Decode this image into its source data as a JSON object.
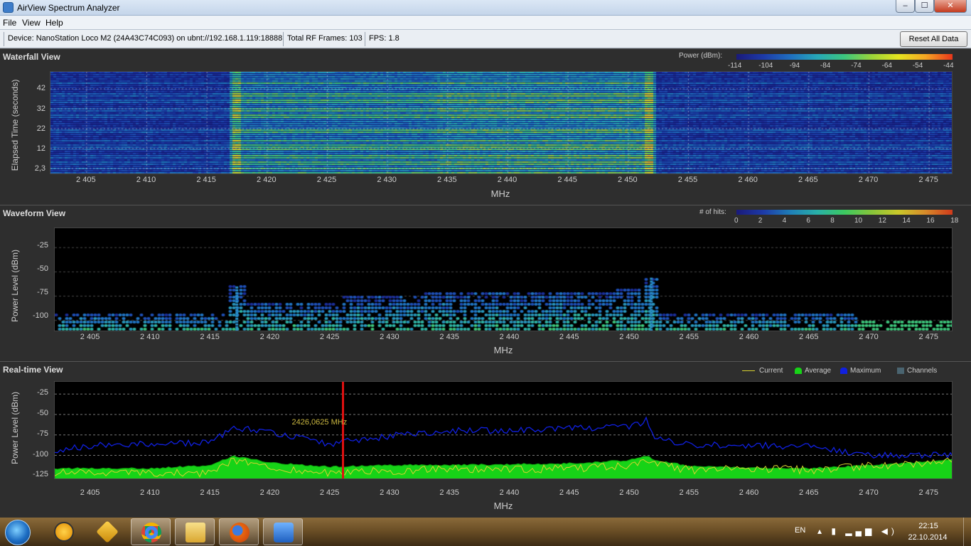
{
  "window": {
    "title": "AirView Spectrum Analyzer",
    "controls": {
      "minimize": "–",
      "maximize": "☐",
      "close": "✕"
    }
  },
  "menu": [
    "File",
    "View",
    "Help"
  ],
  "toolbar": {
    "device": "Device: NanoStation Loco M2 (24A43C74C093) on ubnt://192.168.1.119:18888",
    "frames": "Total RF Frames: 103",
    "fps": "FPS: 1.8",
    "reset_label": "Reset All Data"
  },
  "x_axis": {
    "unit": "MHz",
    "ticks": [
      "2 405",
      "2 410",
      "2 415",
      "2 420",
      "2 425",
      "2 430",
      "2 435",
      "2 440",
      "2 445",
      "2 450",
      "2 455",
      "2 460",
      "2 465",
      "2 470",
      "2 475"
    ]
  },
  "waterfall": {
    "title": "Waterfall View",
    "ylabel": "Elapsed Time (seconds)",
    "yticks": [
      "42",
      "32",
      "22",
      "12",
      "2,3"
    ],
    "legend_label": "Power (dBm):",
    "legend_ticks": [
      "-114",
      "-104",
      "-94",
      "-84",
      "-74",
      "-64",
      "-54",
      "-44"
    ]
  },
  "waveform": {
    "title": "Waveform View",
    "ylabel": "Power Level (dBm)",
    "yticks": [
      "-25",
      "-50",
      "-75",
      "-100"
    ],
    "legend_label": "# of hits:",
    "legend_ticks": [
      "0",
      "2",
      "4",
      "6",
      "8",
      "10",
      "12",
      "14",
      "16",
      "18"
    ]
  },
  "realtime": {
    "title": "Real-time View",
    "ylabel": "Power Level (dBm)",
    "yticks": [
      "-25",
      "-50",
      "-75",
      "-100",
      "-125"
    ],
    "legend": [
      {
        "name": "Current",
        "color": "#d9d230"
      },
      {
        "name": "Average",
        "color": "#17d317"
      },
      {
        "name": "Maximum",
        "color": "#1020e0"
      },
      {
        "name": "Channels",
        "color": "#4a6470"
      }
    ],
    "marker_label": "2426,0625 MHz"
  },
  "chart_data": [
    {
      "type": "heatmap",
      "title": "Waterfall View",
      "xlabel": "MHz",
      "ylabel": "Elapsed Time (seconds)",
      "xlim": [
        2402,
        2477
      ],
      "ylim": [
        0,
        49
      ],
      "colorbar": {
        "label": "Power (dBm)",
        "range": [
          -114,
          -44
        ]
      },
      "active_bands_mhz": [
        [
          2417,
          2434
        ],
        [
          2434,
          2452
        ]
      ]
    },
    {
      "type": "heatmap",
      "title": "Waveform View",
      "xlabel": "MHz",
      "ylabel": "Power Level (dBm)",
      "xlim": [
        2402,
        2477
      ],
      "ylim": [
        -112,
        -5
      ],
      "colorbar": {
        "label": "# of hits",
        "range": [
          0,
          18
        ]
      }
    },
    {
      "type": "line",
      "title": "Real-time View",
      "xlabel": "MHz",
      "ylabel": "Power Level (dBm)",
      "xlim": [
        2402,
        2477
      ],
      "ylim": [
        -130,
        -10
      ],
      "x": [
        2402,
        2405,
        2410,
        2415,
        2417,
        2420,
        2425,
        2430,
        2435,
        2440,
        2445,
        2450,
        2451.5,
        2452,
        2455,
        2460,
        2465,
        2470,
        2475,
        2477
      ],
      "series": [
        {
          "name": "Maximum",
          "values": [
            -95,
            -88,
            -86,
            -85,
            -66,
            -72,
            -86,
            -76,
            -70,
            -69,
            -67,
            -66,
            -56,
            -80,
            -87,
            -88,
            -89,
            -100,
            -100,
            -100
          ]
        },
        {
          "name": "Average",
          "values": [
            -116,
            -116,
            -116,
            -112,
            -101,
            -109,
            -114,
            -112,
            -112,
            -111,
            -110,
            -106,
            -100,
            -106,
            -113,
            -115,
            -116,
            -112,
            -108,
            -105
          ]
        },
        {
          "name": "Current",
          "values": [
            -121,
            -121,
            -121,
            -122,
            -106,
            -116,
            -121,
            -119,
            -117,
            -118,
            -116,
            -112,
            -104,
            -110,
            -118,
            -116,
            -118,
            -113,
            -109,
            -107
          ]
        }
      ],
      "marker": {
        "label": "2426,0625 MHz",
        "x": 2426.0625
      }
    }
  ],
  "taskbar": {
    "apps": [
      {
        "name": "AvidemuxLike",
        "icon": "avast-icon"
      },
      {
        "name": "Winamp",
        "icon": "winamp-icon"
      },
      {
        "name": "Chrome",
        "icon": "chrome-icon"
      },
      {
        "name": "Explorer",
        "icon": "folder-icon"
      },
      {
        "name": "Firefox",
        "icon": "firefox-icon"
      },
      {
        "name": "AirView",
        "icon": "airview-icon"
      }
    ],
    "lang": "EN",
    "time": "22:15",
    "date": "22.10.2014"
  }
}
